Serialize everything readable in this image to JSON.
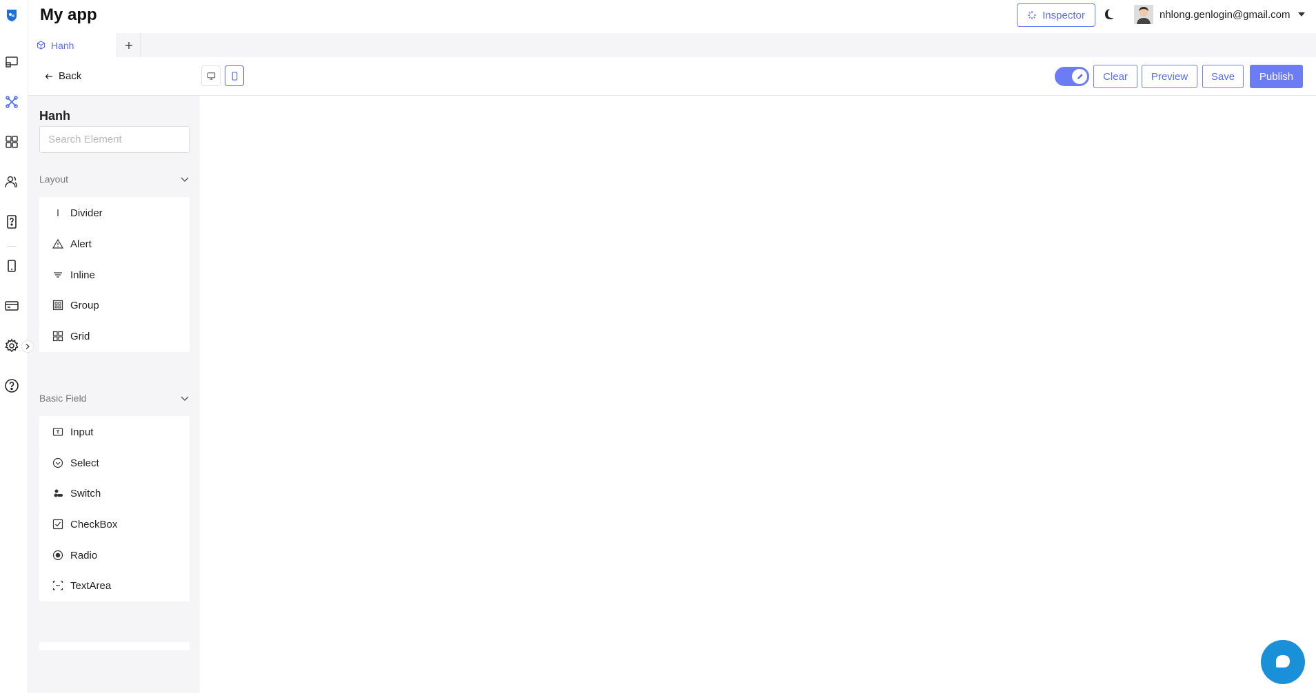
{
  "header": {
    "app_title": "My app",
    "inspector_label": "Inspector",
    "user_email": "nhlong.genlogin@gmail.com"
  },
  "tabs": [
    {
      "label": "Hanh"
    }
  ],
  "toolbar": {
    "back_label": "Back",
    "clear_label": "Clear",
    "preview_label": "Preview",
    "save_label": "Save",
    "publish_label": "Publish",
    "edit_mode_on": true
  },
  "panel": {
    "title": "Hanh",
    "search_placeholder": "Search Element",
    "sections": [
      {
        "label": "Layout",
        "items": [
          {
            "label": "Divider",
            "icon": "divider-icon"
          },
          {
            "label": "Alert",
            "icon": "alert-triangle-icon"
          },
          {
            "label": "Inline",
            "icon": "inline-icon"
          },
          {
            "label": "Group",
            "icon": "group-icon"
          },
          {
            "label": "Grid",
            "icon": "grid-icon"
          }
        ]
      },
      {
        "label": "Basic Field",
        "items": [
          {
            "label": "Input",
            "icon": "input-icon"
          },
          {
            "label": "Select",
            "icon": "select-icon"
          },
          {
            "label": "Switch",
            "icon": "switch-icon"
          },
          {
            "label": "CheckBox",
            "icon": "checkbox-icon"
          },
          {
            "label": "Radio",
            "icon": "radio-icon"
          },
          {
            "label": "TextArea",
            "icon": "textarea-icon"
          }
        ]
      }
    ]
  },
  "colors": {
    "accent": "#6b7cf5",
    "chat": "#1a90d9",
    "panel_bg": "#f5f5f7"
  }
}
